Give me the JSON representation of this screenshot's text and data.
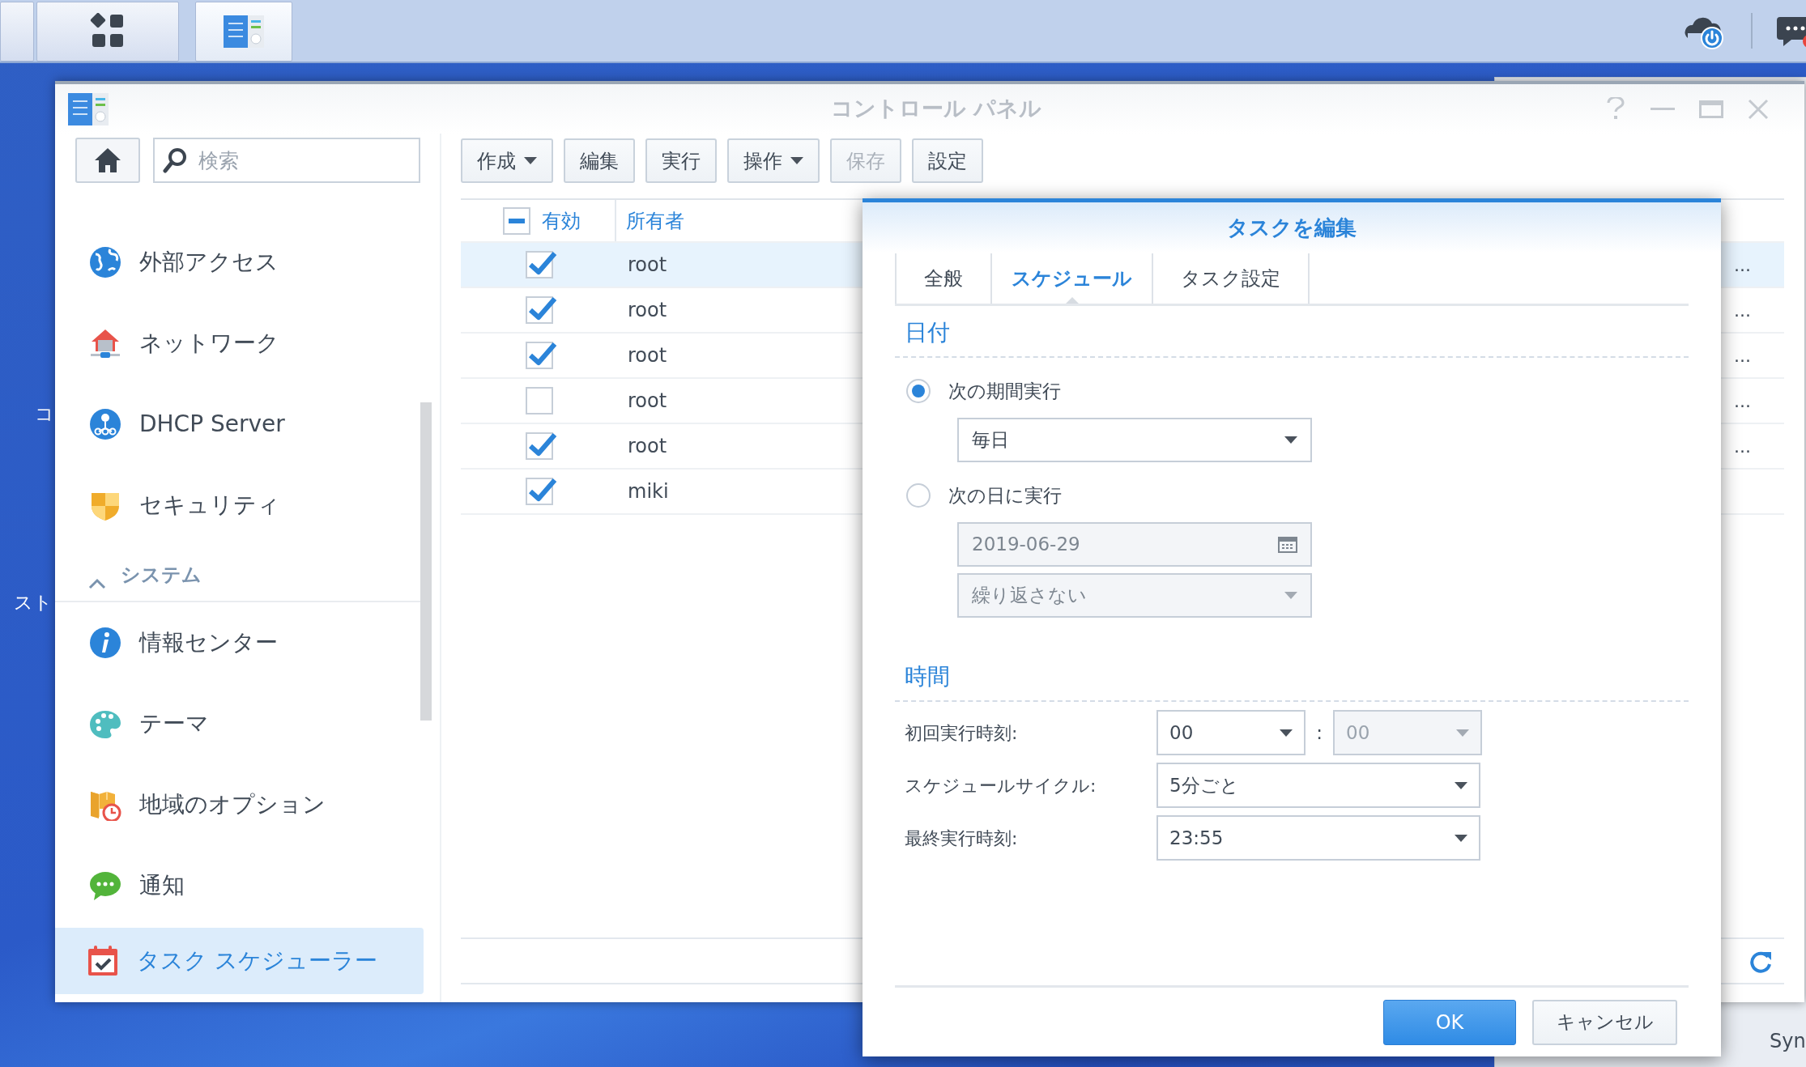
{
  "desktop_labels": [
    "コ",
    "スト"
  ],
  "background_window": {
    "text": "Syn"
  },
  "window": {
    "title": "コントロール パネル"
  },
  "search": {
    "placeholder": "検索"
  },
  "sidebar": {
    "groups": [
      {
        "items": [
          {
            "label": "外部アクセス",
            "selected": false
          },
          {
            "label": "ネットワーク",
            "selected": false
          },
          {
            "label": "DHCP Server",
            "selected": false
          },
          {
            "label": "セキュリティ",
            "selected": false
          }
        ]
      },
      {
        "title": "システム",
        "expanded": true,
        "items": [
          {
            "label": "情報センター",
            "selected": false
          },
          {
            "label": "テーマ",
            "selected": false
          },
          {
            "label": "地域のオプション",
            "selected": false
          },
          {
            "label": "通知",
            "selected": false
          },
          {
            "label": "タスク スケジューラー",
            "selected": true
          }
        ]
      }
    ]
  },
  "toolbar": [
    {
      "label": "作成",
      "dropdown": true,
      "disabled": false
    },
    {
      "label": "編集",
      "dropdown": false,
      "disabled": false
    },
    {
      "label": "実行",
      "dropdown": false,
      "disabled": false
    },
    {
      "label": "操作",
      "dropdown": true,
      "disabled": false
    },
    {
      "label": "保存",
      "dropdown": false,
      "disabled": true
    },
    {
      "label": "設定",
      "dropdown": false,
      "disabled": false
    }
  ],
  "table": {
    "columns": [
      "有効",
      "所有者"
    ],
    "header_checkbox": {
      "indeterminate": true
    },
    "rows": [
      {
        "enabled": true,
        "owner": "root",
        "column_3": "...",
        "selected": true
      },
      {
        "enabled": true,
        "owner": "root",
        "column_3": "...",
        "selected": false
      },
      {
        "enabled": true,
        "owner": "root",
        "column_3": "...",
        "selected": false
      },
      {
        "enabled": false,
        "owner": "root",
        "column_3": "...",
        "selected": false
      },
      {
        "enabled": true,
        "owner": "root",
        "column_3": "...",
        "selected": false
      },
      {
        "enabled": true,
        "owner": "miki",
        "selected": false
      }
    ]
  },
  "dialog": {
    "title": "タスクを編集",
    "tabs": [
      {
        "label": "全般",
        "selected": false
      },
      {
        "label": "スケジュール",
        "selected": true
      },
      {
        "label": "タスク設定",
        "selected": false
      }
    ],
    "date_section": {
      "heading": "日付",
      "options": [
        {
          "label": "次の期間実行",
          "selected": true,
          "field": {
            "kind": "select",
            "value": "毎日",
            "disabled": false
          }
        },
        {
          "label": "次の日に実行",
          "selected": false,
          "field": {
            "kind": "date",
            "value": "2019-06-29",
            "disabled": true
          }
        }
      ],
      "repeat": {
        "value": "繰り返さない",
        "disabled": true
      }
    },
    "time_section": {
      "heading": "時間",
      "rows": [
        {
          "label": "初回実行時刻:",
          "separator": ":",
          "selects": [
            {
              "value": "00",
              "disabled": false
            },
            {
              "value": "00",
              "disabled": true
            }
          ]
        },
        {
          "label": "スケジュールサイクル:",
          "selects": [
            {
              "value": "5分ごと",
              "disabled": false
            }
          ]
        },
        {
          "label": "最終実行時刻:",
          "selects": [
            {
              "value": "23:55",
              "disabled": false
            }
          ]
        }
      ]
    },
    "buttons": [
      {
        "label": "OK",
        "kind": "primary"
      },
      {
        "label": "キャンセル",
        "kind": "secondary"
      }
    ]
  }
}
